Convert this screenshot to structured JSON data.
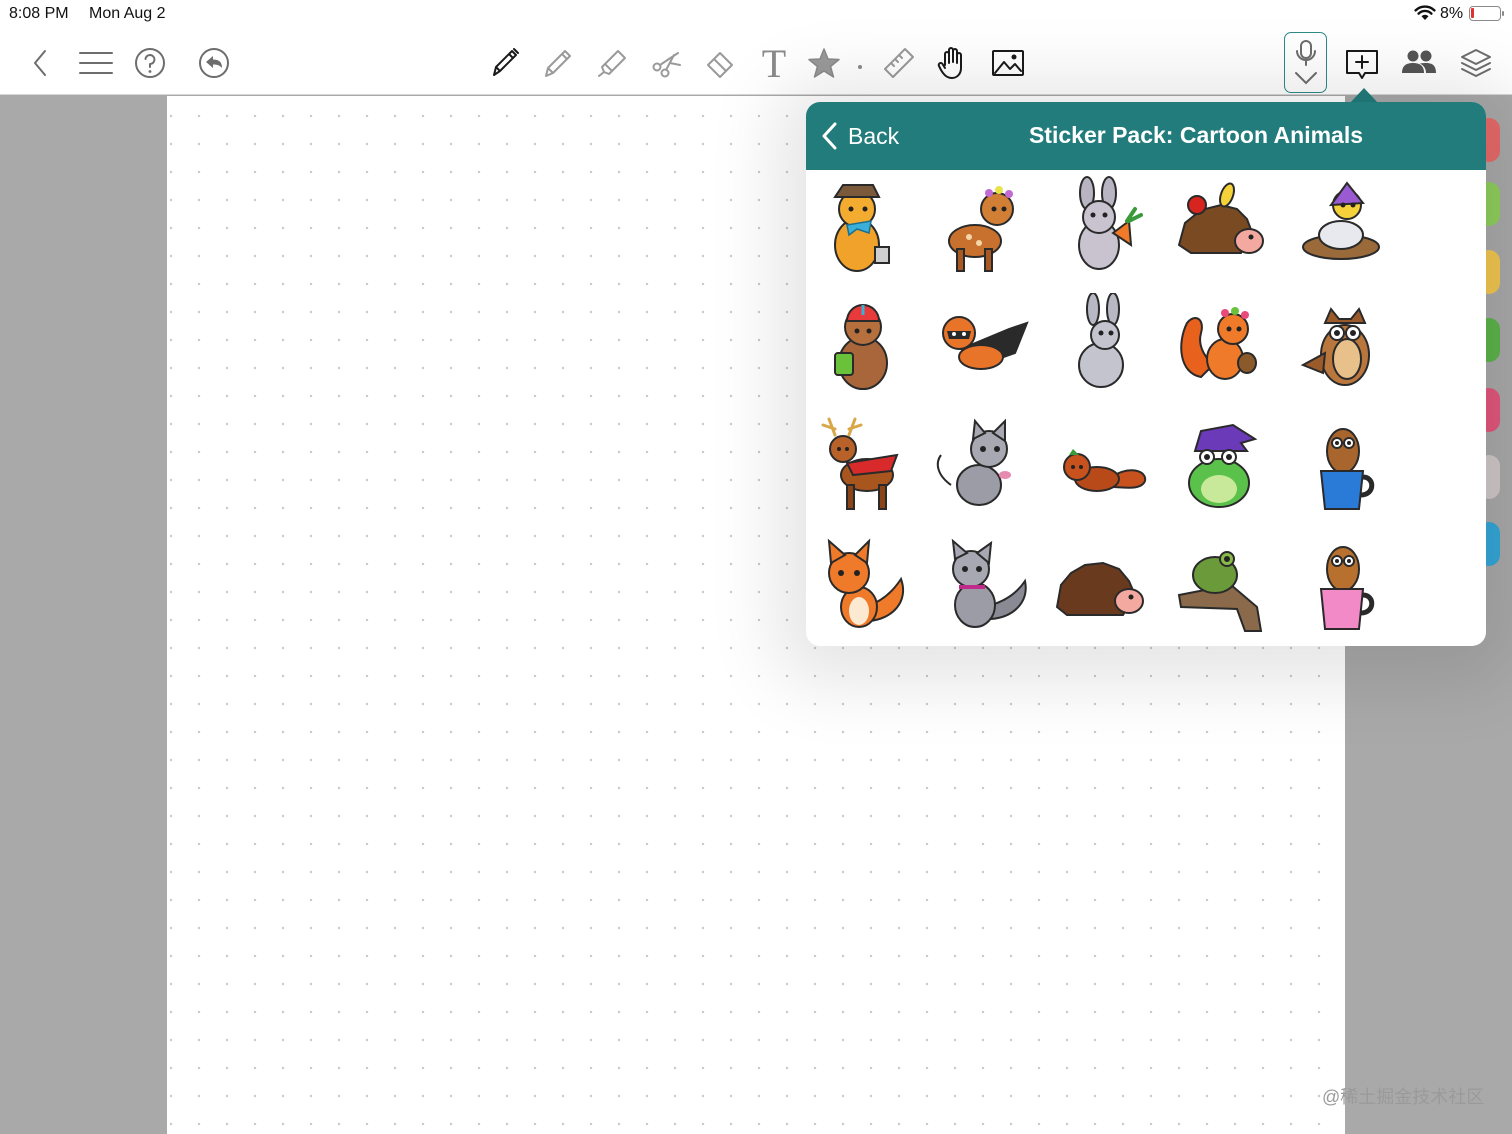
{
  "status_bar": {
    "time": "8:08 PM",
    "date": "Mon Aug 2",
    "battery": "8%",
    "battery_color": "#e0332f"
  },
  "toolbar": {
    "left": [
      "back-chevron-icon",
      "menu-icon",
      "help-icon",
      "undo-icon"
    ],
    "tools": [
      "pen-icon",
      "pencil-icon",
      "highlighter-icon",
      "lasso-scissors-icon",
      "eraser-icon",
      "text-tool-icon",
      "sticker-star-icon",
      "ruler-icon",
      "hand-pan-icon",
      "image-icon"
    ],
    "text_tool_glyph": "T",
    "right": [
      "microphone-icon",
      "add-page-icon",
      "collaborators-icon",
      "layers-icon"
    ],
    "accent": "#2e8a8a"
  },
  "popover": {
    "back_label": "Back",
    "title": "Sticker Pack: Cartoon Animals",
    "header_color": "#237c7c",
    "stickers": [
      "bear-in-hat-sticker",
      "deer-with-flowers-sticker",
      "bunny-with-carrot-sticker",
      "hedgehog-with-fruit-sticker",
      "bird-in-nest-sticker",
      "bear-with-honey-sticker",
      "raccoon-fox-caped-sticker",
      "gray-bunny-sticker",
      "squirrel-with-acorn-sticker",
      "owl-sticker",
      "reindeer-with-scarf-sticker",
      "gray-cat-sticker",
      "red-panda-sticker",
      "frog-witch-hat-sticker",
      "owl-in-blue-mug-sticker",
      "fox-sticker",
      "wolf-pup-sticker",
      "hedgehog-sticker",
      "frog-on-branch-sticker",
      "owl-in-pink-mug-sticker"
    ]
  },
  "side_tabs": [
    "#e86a6a",
    "#8fcf5c",
    "#f2c650",
    "#5cb34a",
    "#e2577c",
    "#d0c8c8",
    "#34a6d8"
  ],
  "watermark": "@稀土掘金技术社区"
}
